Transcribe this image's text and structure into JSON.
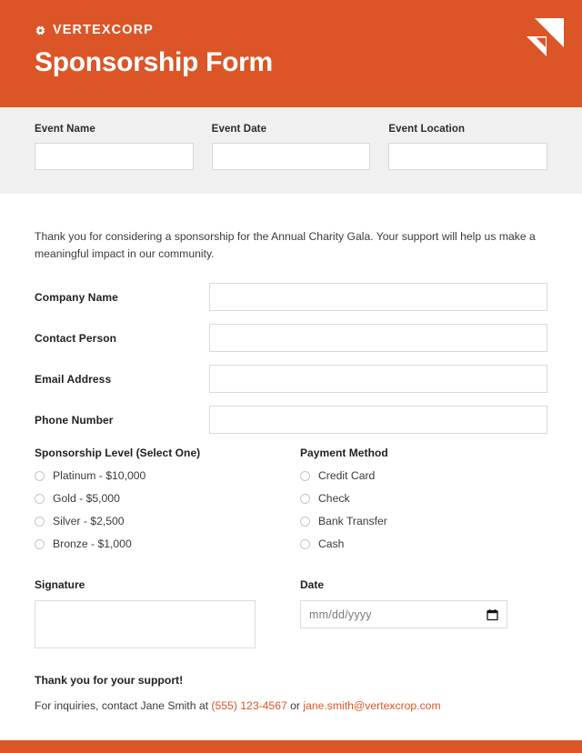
{
  "brand": {
    "icon": "gear-icon",
    "name": "VERTEXCORP",
    "logo_icon": "triangle-logo-mark",
    "accent_color": "#DC5527"
  },
  "header": {
    "title": "Sponsorship Form"
  },
  "event_band": {
    "background_color": "#F0F0F0",
    "fields": [
      {
        "label": "Event Name",
        "value": "",
        "placeholder": ""
      },
      {
        "label": "Event Date",
        "value": "",
        "placeholder": ""
      },
      {
        "label": "Event Location",
        "value": "",
        "placeholder": ""
      }
    ]
  },
  "intro": {
    "text": "Thank you for considering a sponsorship for the Annual Charity Gala. Your support will help us make a meaningful impact in our community."
  },
  "contact_fields": [
    {
      "label": "Company Name",
      "value": "",
      "placeholder": ""
    },
    {
      "label": "Contact Person",
      "value": "",
      "placeholder": ""
    },
    {
      "label": "Email Address",
      "value": "",
      "placeholder": ""
    },
    {
      "label": "Phone Number",
      "value": "",
      "placeholder": ""
    }
  ],
  "sponsorship_level": {
    "title": "Sponsorship Level (Select One)",
    "options": [
      {
        "label": "Platinum - $10,000",
        "selected": false
      },
      {
        "label": "Gold - $5,000",
        "selected": false
      },
      {
        "label": "Silver - $2,500",
        "selected": false
      },
      {
        "label": "Bronze - $1,000",
        "selected": false
      }
    ]
  },
  "payment_method": {
    "title": "Payment Method",
    "options": [
      {
        "label": "Credit Card",
        "selected": false
      },
      {
        "label": "Check",
        "selected": false
      },
      {
        "label": "Bank Transfer",
        "selected": false
      },
      {
        "label": "Cash",
        "selected": false
      }
    ]
  },
  "signature": {
    "label": "Signature",
    "value": ""
  },
  "date": {
    "label": "Date",
    "placeholder": "mm/dd/yyyy",
    "value": "",
    "icon": "calendar-icon"
  },
  "footer": {
    "thanks": "Thank you for your support!",
    "inquiries_prefix": "For inquiries, contact Jane Smith at ",
    "phone": "(555) 123-4567",
    "conjunction": " or ",
    "email": "jane.smith@vertexcrop.com"
  }
}
